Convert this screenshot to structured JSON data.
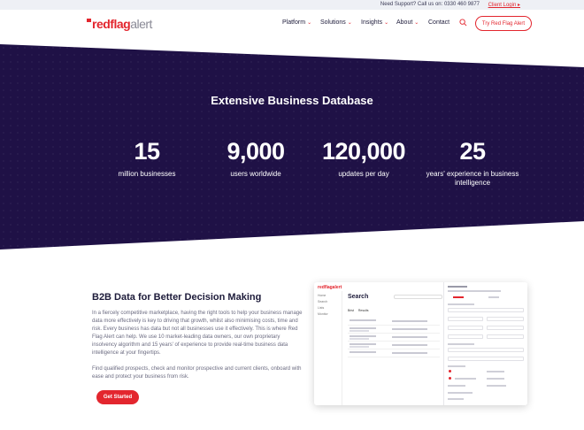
{
  "topbar": {
    "support": "Need Support? Call us on: 0330 460 9877",
    "login": "Client Login ▸"
  },
  "nav": {
    "logo_red": "redflag",
    "logo_grey": "alert",
    "items": [
      {
        "label": "Platform",
        "has_dropdown": true
      },
      {
        "label": "Solutions",
        "has_dropdown": true
      },
      {
        "label": "Insights",
        "has_dropdown": true
      },
      {
        "label": "About",
        "has_dropdown": true
      },
      {
        "label": "Contact",
        "has_dropdown": false
      }
    ],
    "search_icon": "search-icon",
    "cta": "Try Red Flag Alert"
  },
  "hero": {
    "title": "Extensive Business Database",
    "stats": [
      {
        "value": "15",
        "label": "million businesses"
      },
      {
        "value": "9,000",
        "label": "users worldwide"
      },
      {
        "value": "120,000",
        "label": "updates per day"
      },
      {
        "value": "25",
        "label": "years' experience in business intelligence"
      }
    ]
  },
  "section": {
    "title": "B2B Data for Better Decision Making",
    "para1": "In a fiercely competitive marketplace, having the right tools to help your business manage data more effectively is key to driving that growth, whilst also minimising costs, time and risk. Every business has data but not all businesses use it effectively. This is where Red Flag Alert can help. We use 10 market-leading data owners, our own proprietary insolvency algorithm and 15 years' of experience to provide real-time business data intelligence at your fingertips.",
    "para2": "Find qualified prospects, check and monitor prospective and current clients, onboard with ease and protect your business from risk.",
    "cta": "Get Started"
  },
  "mockup": {
    "logo": "redflagalert",
    "title": "Search",
    "sidebar": [
      "Home",
      "Search",
      "Lists",
      "Monitor"
    ],
    "tabs": [
      "Brist",
      "Results"
    ]
  },
  "colors": {
    "brand_red": "#e3262e",
    "hero_bg": "#1f1146",
    "text_dark": "#1d1b3a"
  }
}
